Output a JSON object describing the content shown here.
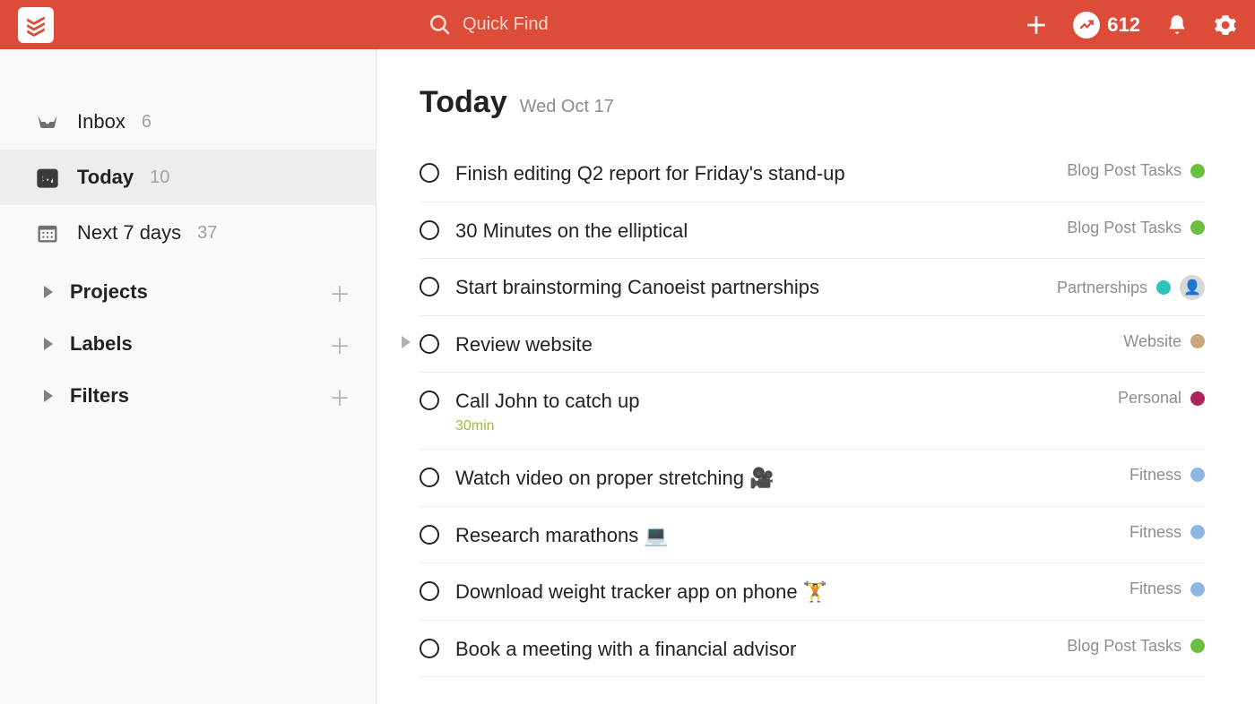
{
  "topbar": {
    "search_placeholder": "Quick Find",
    "karma_count": "612"
  },
  "sidebar": {
    "nav": [
      {
        "id": "inbox",
        "label": "Inbox",
        "count": "6",
        "active": false
      },
      {
        "id": "today",
        "label": "Today",
        "count": "10",
        "active": true
      },
      {
        "id": "next7",
        "label": "Next 7 days",
        "count": "37",
        "active": false
      }
    ],
    "sections": {
      "projects": "Projects",
      "labels": "Labels",
      "filters": "Filters"
    }
  },
  "main": {
    "title": "Today",
    "date": "Wed Oct 17",
    "tasks": [
      {
        "title": "Finish editing Q2 report for Friday's stand-up",
        "priority": "red",
        "project": "Blog Post Tasks",
        "project_color": "green"
      },
      {
        "title": "30 Minutes on the elliptical",
        "priority": "red",
        "project": "Blog Post Tasks",
        "project_color": "green"
      },
      {
        "title": "Start brainstorming Canoeist partnerships",
        "priority": "red",
        "project": "Partnerships",
        "project_color": "teal",
        "has_avatar": true
      },
      {
        "title": "Review website",
        "priority": "orange",
        "project": "Website",
        "project_color": "tan",
        "has_subtasks": true
      },
      {
        "title": "Call John to catch up",
        "priority": "yellow",
        "project": "Personal",
        "project_color": "magenta",
        "subtitle": "30min"
      },
      {
        "title": "Watch video on proper stretching 🎥",
        "priority": "yellow",
        "project": "Fitness",
        "project_color": "blue"
      },
      {
        "title": "Research marathons 💻",
        "priority": "yellow",
        "project": "Fitness",
        "project_color": "blue"
      },
      {
        "title": "Download weight tracker app on phone 🏋️",
        "priority": "yellow",
        "project": "Fitness",
        "project_color": "blue"
      },
      {
        "title": "Book a meeting with a financial advisor",
        "priority": "yellow",
        "project": "Blog Post Tasks",
        "project_color": "green"
      }
    ]
  }
}
